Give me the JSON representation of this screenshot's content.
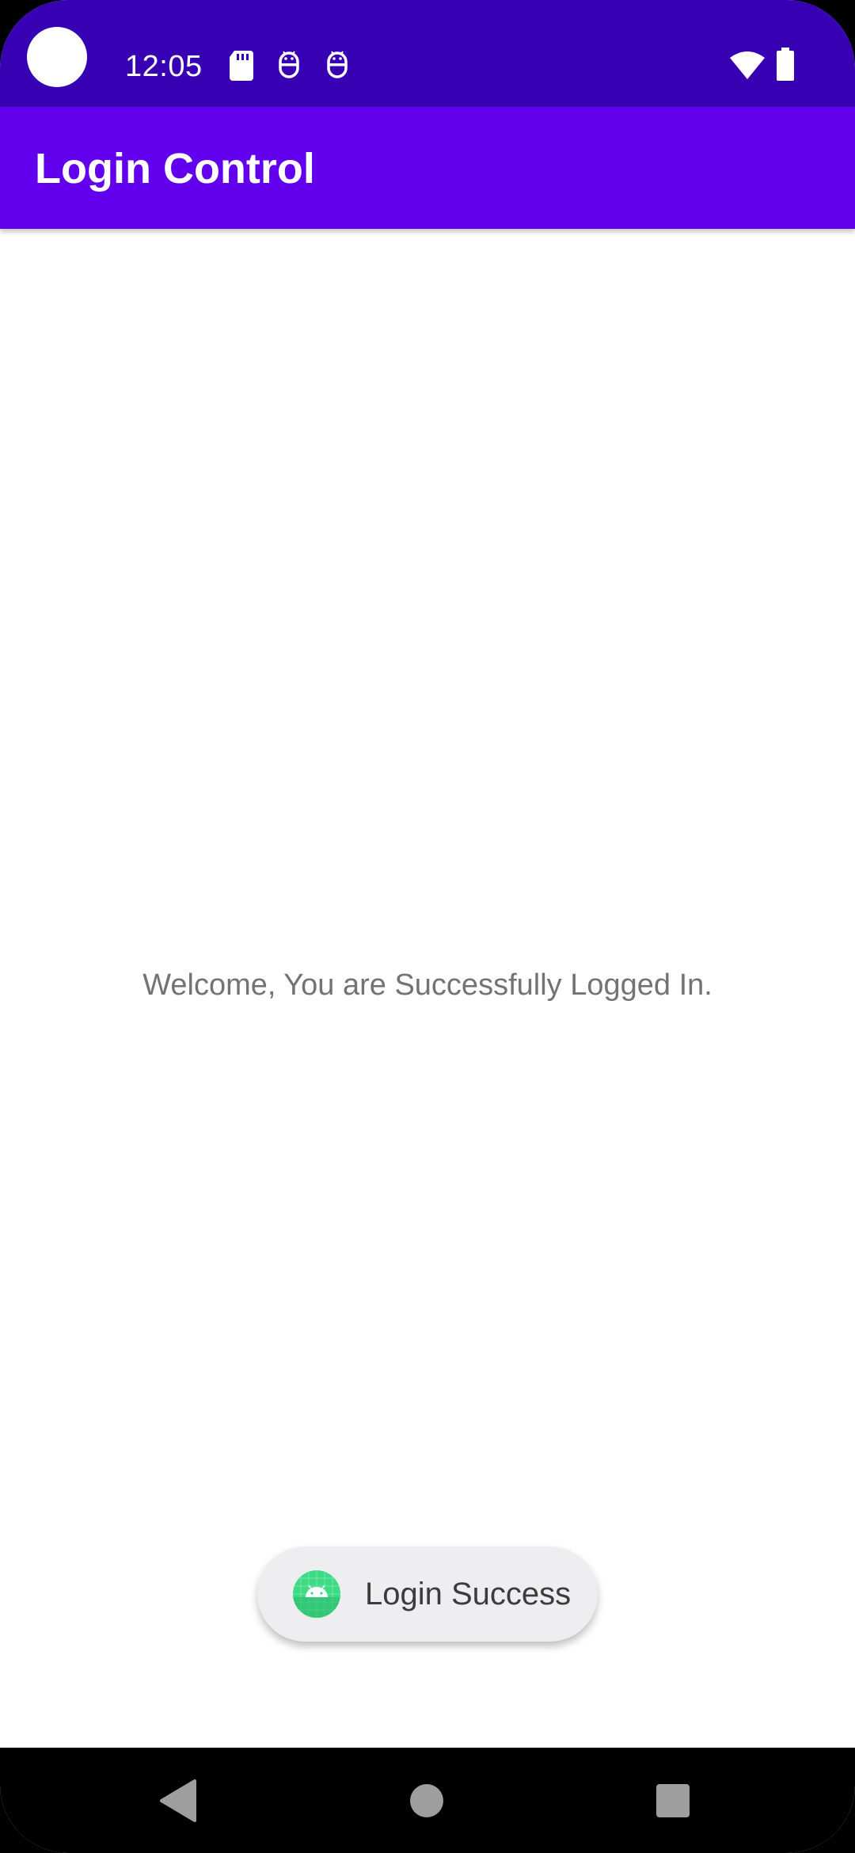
{
  "status_bar": {
    "time": "12:05",
    "icons": [
      "sd-card-icon",
      "android-debug-icon",
      "android-debug-icon",
      "wifi-icon",
      "battery-icon"
    ],
    "background_color": "#3700b3"
  },
  "app_bar": {
    "title": "Login Control",
    "background_color": "#6200ee"
  },
  "main": {
    "welcome_message": "Welcome, You are Successfully Logged In."
  },
  "toast": {
    "icon": "android-app-icon",
    "message": "Login Success"
  },
  "nav_bar": {
    "buttons": [
      "back-icon",
      "home-icon",
      "recents-icon"
    ]
  }
}
